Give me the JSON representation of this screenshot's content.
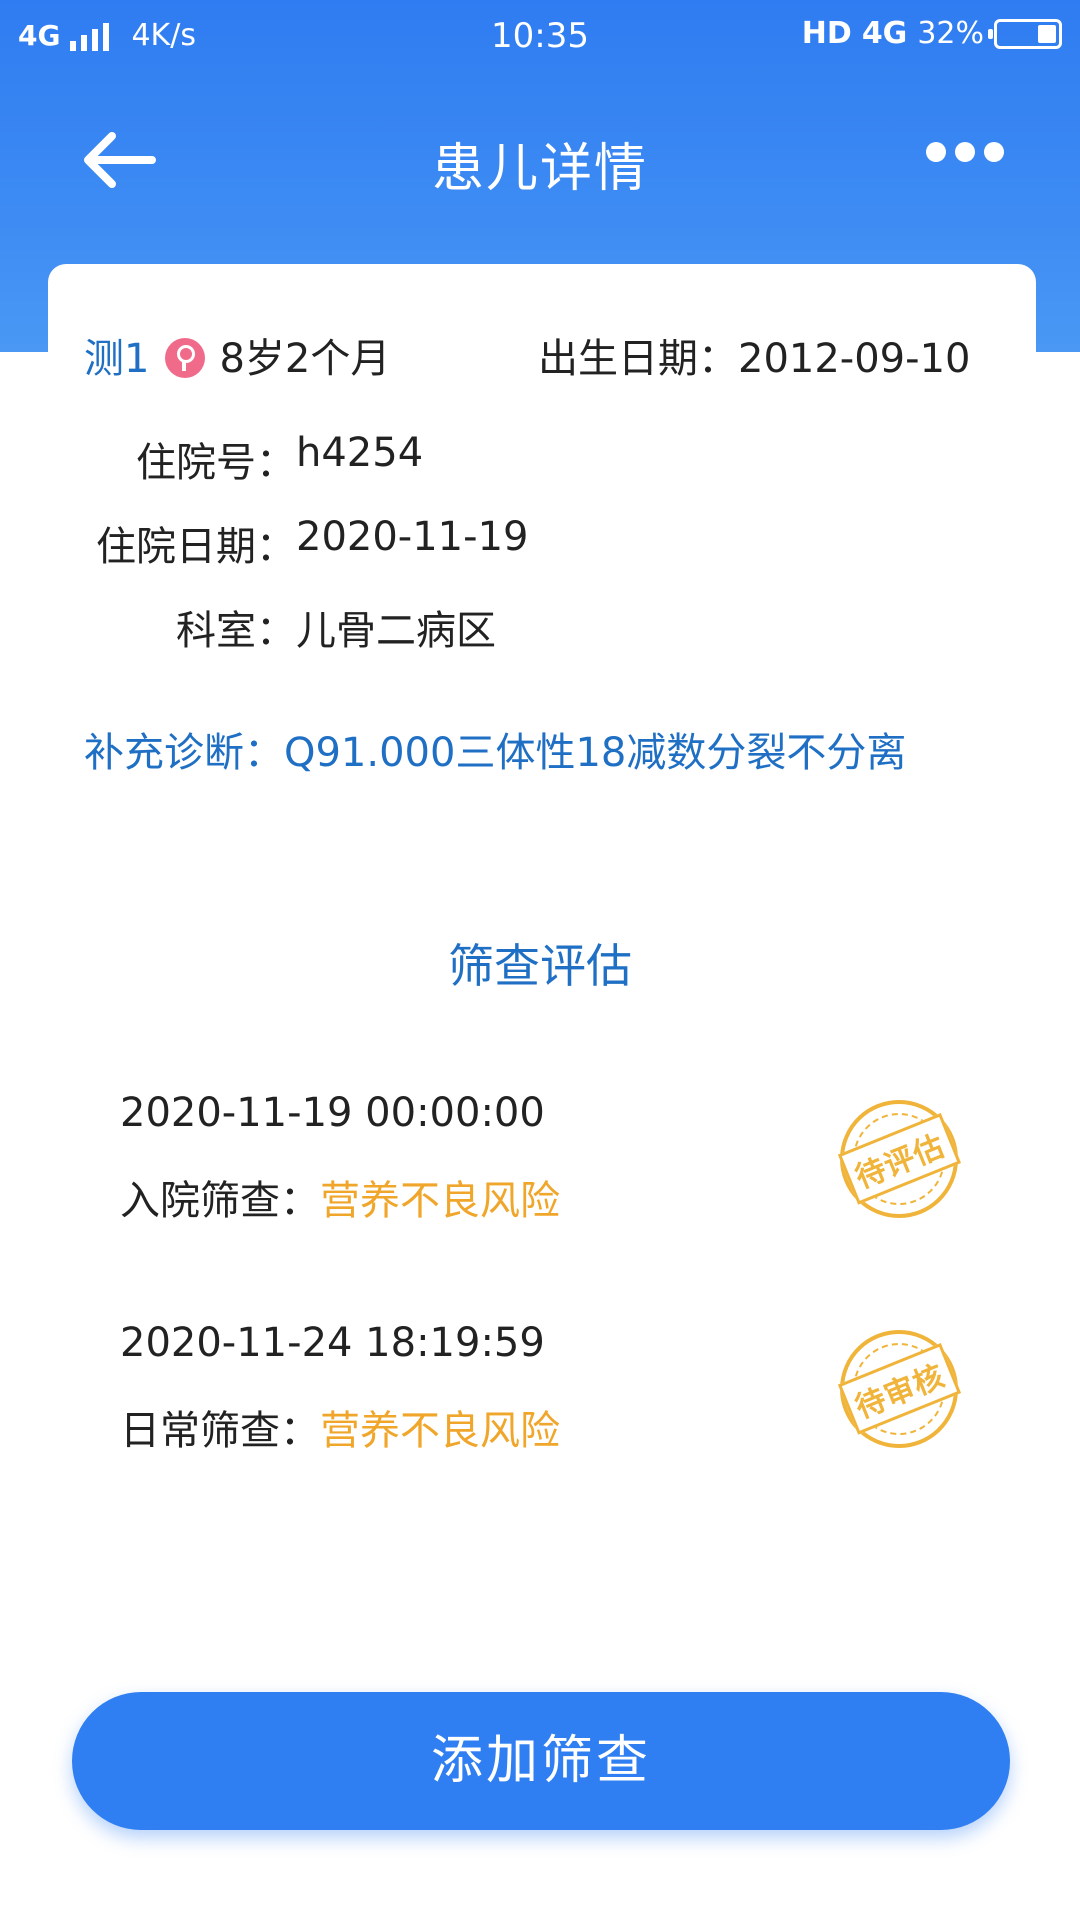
{
  "status_bar": {
    "network": "4G",
    "speed": "4K/s",
    "time": "10:35",
    "hd": "HD",
    "network_right": "4G",
    "battery": "32%"
  },
  "nav": {
    "title": "患儿详情",
    "back_icon": "arrow-left-icon",
    "more_icon": "more-dots-icon"
  },
  "patient": {
    "name": "测1",
    "gender_icon": "female-icon",
    "age": "8岁2个月",
    "birth_label": "出生日期：",
    "birth_date": "2012-09-10",
    "hospital_no_label": "住院号：",
    "hospital_no": "h4254",
    "admission_date_label": "住院日期：",
    "admission_date": "2020-11-19",
    "department_label": "科室：",
    "department": "儿骨二病区",
    "diagnosis_label": "补充诊断：",
    "diagnosis": "Q91.000三体性18减数分裂不分离"
  },
  "screening": {
    "section_title": "筛查评估",
    "records": [
      {
        "datetime": "2020-11-19 00:00:00",
        "type_label": "入院筛查：",
        "result": "营养不良风险",
        "stamp": "待评估"
      },
      {
        "datetime": "2020-11-24 18:19:59",
        "type_label": "日常筛查：",
        "result": "营养不良风险",
        "stamp": "待审核"
      }
    ]
  },
  "actions": {
    "add_label": "添加筛查"
  },
  "colors": {
    "primary": "#2f7ff3",
    "link_blue": "#1f6fc4",
    "warning_orange": "#f0a62a",
    "female_pink": "#f06b8a"
  }
}
